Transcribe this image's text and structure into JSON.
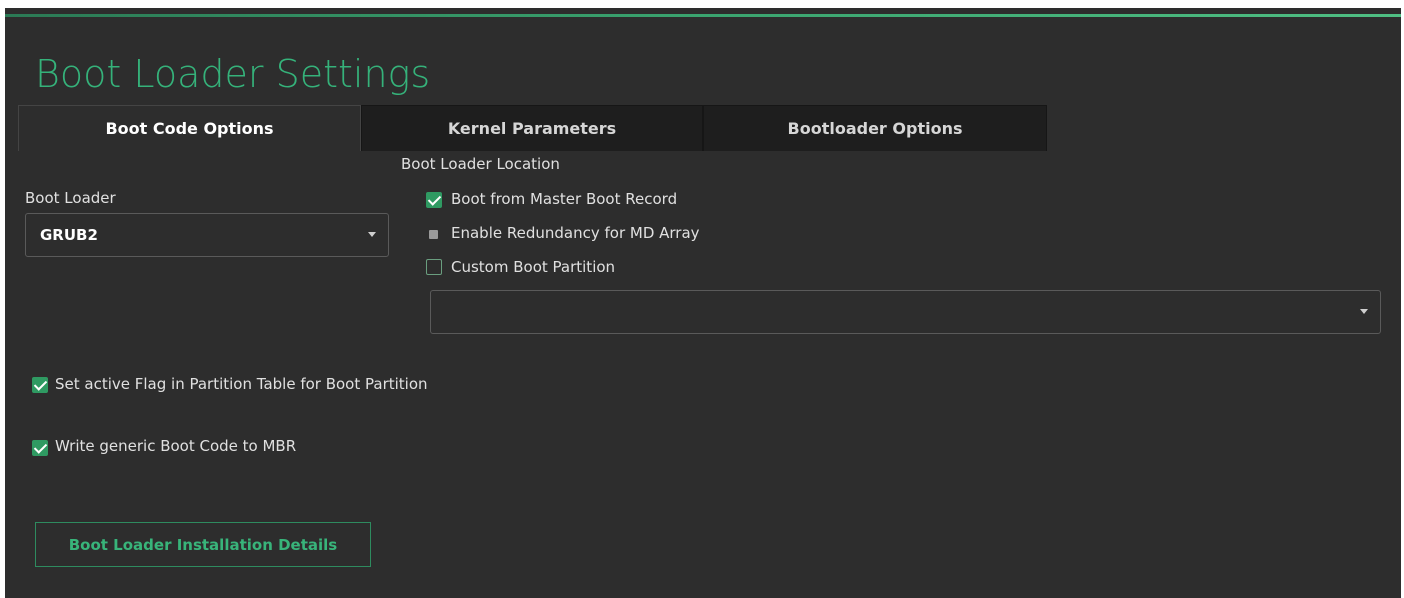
{
  "page": {
    "title": "Boot Loader Settings"
  },
  "tabs": [
    {
      "label": "Boot Code Options",
      "active": true
    },
    {
      "label": "Kernel Parameters",
      "active": false
    },
    {
      "label": "Bootloader Options",
      "active": false
    }
  ],
  "boot_loader": {
    "label": "Boot Loader",
    "value": "GRUB2"
  },
  "location": {
    "heading": "Boot Loader Location",
    "mbr": {
      "label": "Boot from Master Boot Record",
      "checked": true
    },
    "redundancy": {
      "label": "Enable Redundancy for MD Array",
      "state": "indeterminate"
    },
    "custom": {
      "label": "Custom Boot Partition",
      "checked": false
    },
    "custom_partition_value": ""
  },
  "options": {
    "active_flag": {
      "label": "Set active Flag in Partition Table for Boot Partition",
      "checked": true
    },
    "generic_code": {
      "label": "Write generic Boot Code to MBR",
      "checked": true
    }
  },
  "details_button": {
    "label": "Boot Loader Installation Details"
  },
  "colors": {
    "accent": "#35b27a",
    "background": "#2d2d2d",
    "tab_inactive": "#1e1e1e"
  }
}
